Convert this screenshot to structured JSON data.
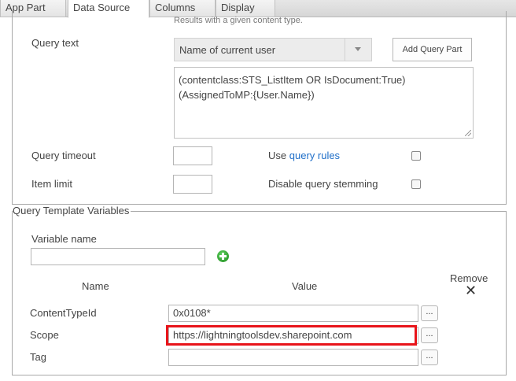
{
  "tabs": [
    {
      "label": "App Part",
      "active": false
    },
    {
      "label": "Data Source",
      "active": true
    },
    {
      "label": "Columns",
      "active": false
    },
    {
      "label": "Display",
      "active": false
    }
  ],
  "query": {
    "hint_text": "Results with a given content type.",
    "query_text_label": "Query text",
    "query_part_selected": "Name of current user",
    "add_query_part_label": "Add Query Part",
    "query_text_value_line1": "(contentclass:STS_ListItem OR IsDocument:True)",
    "query_text_value_line2": "(AssignedToMP:{User.Name})",
    "timeout_label": "Query timeout",
    "timeout_value": "",
    "item_limit_label": "Item limit",
    "item_limit_value": "",
    "use_label": "Use",
    "query_rules_link": "query rules",
    "use_query_rules_checked": false,
    "disable_stemming_label": "Disable query stemming",
    "disable_stemming_checked": false
  },
  "variables": {
    "legend": "Query Template Variables",
    "variable_name_label": "Variable name",
    "variable_name_value": "",
    "col_name": "Name",
    "col_value": "Value",
    "col_remove": "Remove",
    "ellipsis": "...",
    "rows": [
      {
        "name": "ContentTypeId",
        "value": "0x0108*"
      },
      {
        "name": "Scope",
        "value": "https://lightningtoolsdev.sharepoint.com"
      },
      {
        "name": "Tag",
        "value": ""
      }
    ]
  },
  "colors": {
    "highlight": "#e8141a",
    "link": "#1e6ec8",
    "add_icon": "#1d8c1d"
  },
  "icons": {
    "add": "plus-circle-icon",
    "remove": "close-icon",
    "dropdown": "chevron-down-icon"
  }
}
